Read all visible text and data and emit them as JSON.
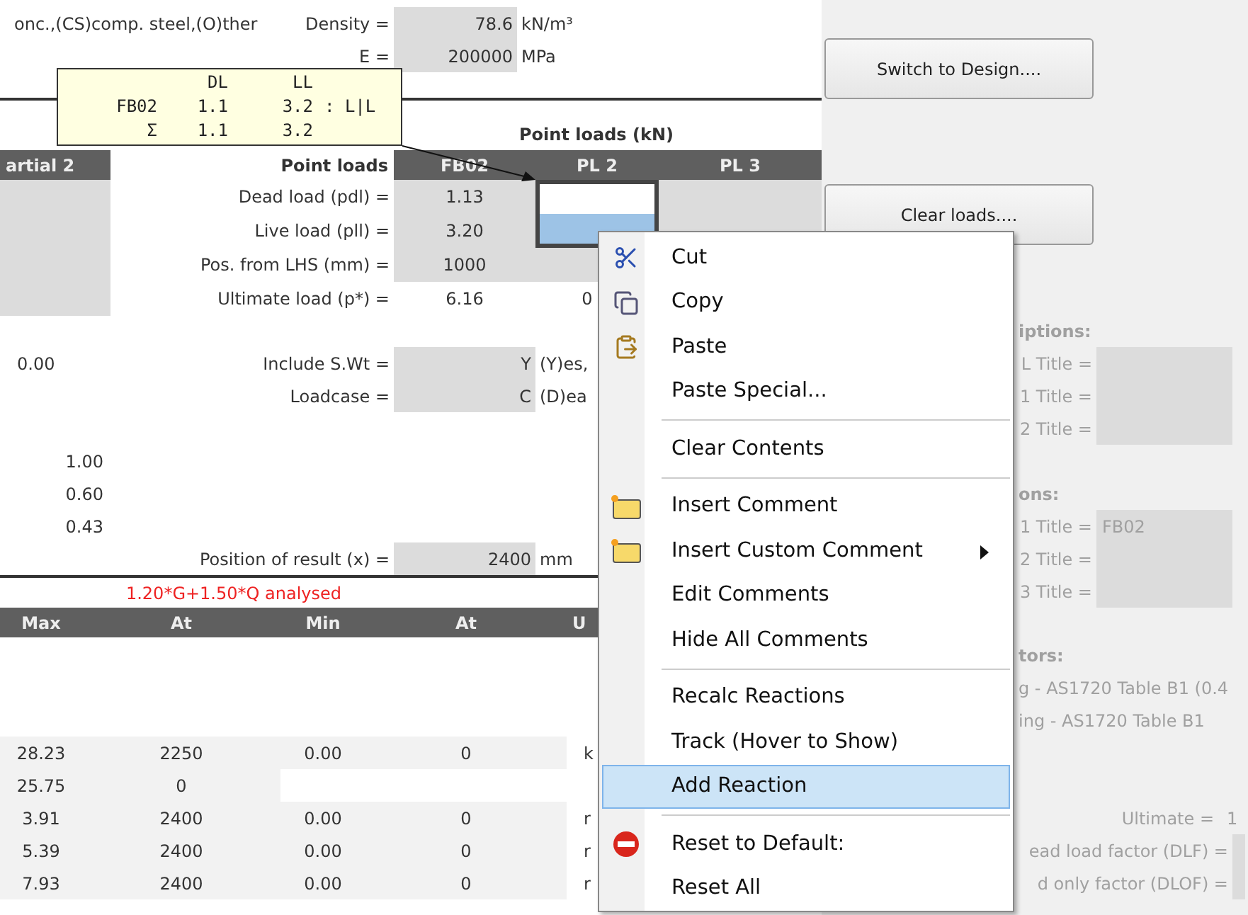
{
  "material_note": "onc.,(CS)comp. steel,(O)ther",
  "properties": [
    {
      "label": "Density =",
      "value": "78.6",
      "unit": "kN/m³"
    },
    {
      "label": "E =",
      "value": "200000",
      "unit": "MPa"
    }
  ],
  "comment": {
    "columns": [
      "DL",
      "LL"
    ],
    "rows": [
      {
        "name": "FB02",
        "values": [
          "1.1",
          "3.2"
        ],
        "suffix": ": L|L"
      },
      {
        "name": "Σ",
        "values": [
          "1.1",
          "3.2"
        ]
      }
    ]
  },
  "point_loads": {
    "title": "Point loads (kN)",
    "side_heading": "artial 2",
    "heading": "Point loads",
    "columns": [
      "FB02",
      "PL 2",
      "PL 3"
    ],
    "rows": [
      {
        "label": "Dead load (pdl) =",
        "input": true,
        "cells": [
          {
            "text": "1.13",
            "selected": false,
            "active": false
          },
          {
            "selected": true,
            "active": true
          },
          {
            "selected": false,
            "active": false
          }
        ]
      },
      {
        "label": "Live load (pll) =",
        "input": true,
        "cells": [
          {
            "text": "3.20",
            "selected": false,
            "active": false
          },
          {
            "selected": true,
            "active": false
          },
          {
            "selected": false,
            "active": false
          }
        ]
      },
      {
        "label": "Pos. from LHS (mm) =",
        "input": true,
        "cells": [
          {
            "text": "1000",
            "selected": false,
            "active": false
          },
          {
            "selected": false,
            "active": false
          }
        ]
      },
      {
        "label": "Ultimate load (p*) =",
        "input": false,
        "cells": [
          {
            "text": "6.16",
            "selected": false,
            "active": false
          },
          {
            "text": "0",
            "selected": false,
            "active": false
          }
        ]
      }
    ]
  },
  "self_weight_value": "0.00",
  "options": [
    {
      "label": "Include S.Wt =",
      "value": "Y",
      "note": "(Y)es,"
    },
    {
      "label": "Loadcase =",
      "value": "C",
      "note": "(D)ea"
    }
  ],
  "factors": [
    "1.00",
    "0.60",
    "0.43"
  ],
  "result_position": {
    "label": "Position of result (x) =",
    "value": "2400",
    "unit": "mm"
  },
  "analysis_note": "1.20*G+1.50*Q analysed",
  "results": {
    "columns": [
      "Max",
      "At",
      "Min",
      "At",
      "U"
    ],
    "rows": [
      [
        "28.23",
        "2250",
        "0.00",
        "0",
        "k"
      ],
      [
        "25.75",
        "0"
      ],
      [
        "3.91",
        "2400",
        "0.00",
        "0",
        "r"
      ],
      [
        "5.39",
        "2400",
        "0.00",
        "0",
        "r"
      ],
      [
        "7.93",
        "2400",
        "0.00",
        "0",
        "r"
      ]
    ]
  },
  "buttons": [
    "Switch to Design....",
    "Clear loads...."
  ],
  "descriptions": {
    "heading": "iptions:",
    "fields": [
      {
        "label": "L Title ="
      },
      {
        "label": "1 Title ="
      },
      {
        "label": "2 Title ="
      }
    ]
  },
  "options_titles": {
    "heading": "ons:",
    "fields": [
      {
        "label": "1 Title =",
        "value": "FB02"
      },
      {
        "label": "2 Title ="
      },
      {
        "label": "3 Title ="
      }
    ]
  },
  "factors_panel": {
    "heading": "tors:",
    "lines": [
      "g - AS1720 Table B1 (0.4",
      "ing - AS1720 Table B1"
    ],
    "ultimate": {
      "label": "Ultimate =",
      "value": "1"
    },
    "fields": [
      {
        "label": "ead load factor (DLF) ="
      },
      {
        "label": "d only factor (DLOF) ="
      }
    ]
  },
  "context_menu": [
    {
      "kind": "item",
      "label": "Cut",
      "selected": false
    },
    {
      "kind": "item",
      "label": "Copy",
      "selected": false
    },
    {
      "kind": "item",
      "label": "Paste",
      "selected": false
    },
    {
      "kind": "item",
      "label": "Paste Special...",
      "selected": false
    },
    {
      "kind": "separator"
    },
    {
      "kind": "item",
      "label": "Clear Contents",
      "selected": false
    },
    {
      "kind": "separator"
    },
    {
      "kind": "item",
      "label": "Insert Comment",
      "selected": false
    },
    {
      "kind": "item",
      "label": "Insert Custom Comment",
      "submenu": true,
      "selected": false
    },
    {
      "kind": "item",
      "label": "Edit Comments",
      "selected": false
    },
    {
      "kind": "item",
      "label": "Hide All Comments",
      "selected": false
    },
    {
      "kind": "separator"
    },
    {
      "kind": "item",
      "label": "Recalc Reactions",
      "selected": false
    },
    {
      "kind": "item",
      "label": "Track (Hover to Show)",
      "selected": false
    },
    {
      "kind": "item",
      "label": "Add Reaction",
      "selected": true
    },
    {
      "kind": "separator"
    },
    {
      "kind": "item",
      "label": "Reset to Default:",
      "selected": false
    },
    {
      "kind": "item",
      "label": "Reset All",
      "selected": false
    }
  ]
}
